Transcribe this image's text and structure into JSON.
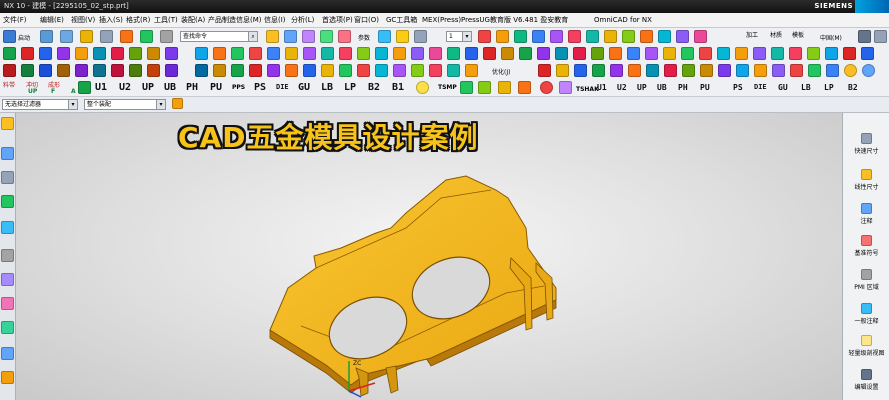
{
  "window": {
    "title": "NX 10 - 建模 - [2295105_02_stp.prt]",
    "brand": "SIEMENS"
  },
  "menu": [
    "文件(F)",
    "编辑(E)",
    "视图(V)",
    "插入(S)",
    "格式(R)",
    "工具(T)",
    "装配(A)",
    "产品制造信息(M)",
    "信息(I)",
    "分析(L)",
    "首选项(P)",
    "窗口(O)",
    "GC工具箱",
    "MEX(Press)",
    "PressUG教育版 V6.481 盈安教育",
    "OmniCAD for NX"
  ],
  "toolbar1": {
    "start_label": "启动",
    "command_finder_placeholder": "查找命令",
    "param_label": "参数",
    "layer_value": "1",
    "prc_label": "中国(M)",
    "process_label": "加工",
    "material_label": "材质",
    "module_label": "模板"
  },
  "toolbar3": {
    "optimize_label": "优化(J)"
  },
  "toolbar4": {
    "material_label": "料带",
    "punch_label": "冲切",
    "form_label": "成形",
    "die_buttons": [
      "U1",
      "U2",
      "UP",
      "UB",
      "PH",
      "PU",
      "PS",
      "DIE",
      "GU",
      "LB",
      "LP",
      "B2",
      "B1"
    ],
    "die_buttons_right": [
      "U1",
      "U2",
      "UP",
      "UB",
      "PH",
      "PU",
      "PS",
      "DIE",
      "GU",
      "LB",
      "LP",
      "B2"
    ],
    "small_labels": [
      "PPS",
      "TSMP",
      "TSHAK"
    ],
    "sub_labels": [
      "UP",
      "F",
      "A"
    ]
  },
  "filter": {
    "type_filter": "无选择过滤器",
    "scope_filter": "整个装配"
  },
  "viewport": {
    "caption": "CAD五金模具设计案例",
    "csys_label": "ZC"
  },
  "right_panel": [
    {
      "icon": "quick-dimension-icon",
      "label": "快速尺寸"
    },
    {
      "icon": "linear-dimension-icon",
      "label": "线性尺寸"
    },
    {
      "icon": "note-icon",
      "label": "注释"
    },
    {
      "icon": "datum-symbol-icon",
      "label": "基准符号"
    },
    {
      "icon": "pmi-region-icon",
      "label": "PMI 区域"
    },
    {
      "icon": "general-note-icon",
      "label": "一般注释"
    },
    {
      "icon": "lightweight-view-icon",
      "label": "轻量级剖视图"
    },
    {
      "icon": "section-view-icon",
      "label": "编辑设置"
    }
  ],
  "colors": {
    "part_face": "#f3b31a",
    "part_edge": "#a86f00",
    "caption": "#f7c21a",
    "brand_blue": "#0066b3"
  }
}
